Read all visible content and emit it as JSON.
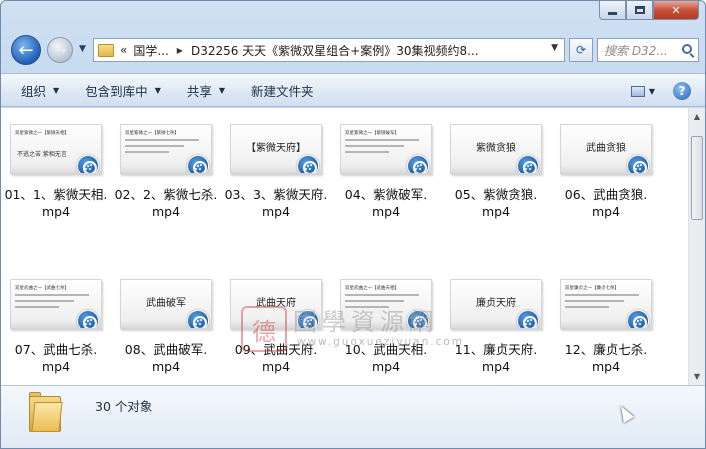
{
  "window": {
    "caption_buttons": [
      "minimize",
      "maximize",
      "close"
    ]
  },
  "address_bar": {
    "chevron": "«",
    "crumbs": [
      "国学...",
      "D32256 天天《紫微双星组合+案例》30集视频约8..."
    ],
    "search_placeholder": "搜索 D32..."
  },
  "toolbar": {
    "organize": "组织",
    "include_in_library": "包含到库中",
    "share": "共享",
    "new_folder": "新建文件夹"
  },
  "files": [
    {
      "name": "01、1、紫微天相.mp4",
      "line1": "01、1、紫微天相.",
      "line2": "mp4",
      "thumb_header": "双星紫微之一【紫微天相】",
      "thumb_big": "",
      "thumb_sub": "不逃之苦    紫相无言"
    },
    {
      "name": "02、2、紫微七杀.mp4",
      "line1": "02、2、紫微七杀.",
      "line2": "mp4",
      "thumb_header": "双星紫微之一【紫微七杀】",
      "thumb_big": "",
      "thumb_sub": ""
    },
    {
      "name": "03、3、紫微天府.mp4",
      "line1": "03、3、紫微天府.",
      "line2": "mp4",
      "thumb_header": "",
      "thumb_big": "【紫微天府】",
      "thumb_sub": ""
    },
    {
      "name": "04、紫微破军.mp4",
      "line1": "04、紫微破军.",
      "line2": "mp4",
      "thumb_header": "双星紫微之一【紫微破军】",
      "thumb_big": "",
      "thumb_sub": ""
    },
    {
      "name": "05、紫微贪狼.mp4",
      "line1": "05、紫微贪狼.",
      "line2": "mp4",
      "thumb_header": "",
      "thumb_big": "紫微贪狼",
      "thumb_sub": ""
    },
    {
      "name": "06、武曲贪狼.mp4",
      "line1": "06、武曲贪狼.",
      "line2": "mp4",
      "thumb_header": "",
      "thumb_big": "武曲贪狼",
      "thumb_sub": ""
    },
    {
      "name": "07、武曲七杀.mp4",
      "line1": "07、武曲七杀.",
      "line2": "mp4",
      "thumb_header": "双星武曲之一【武曲七杀】",
      "thumb_big": "",
      "thumb_sub": ""
    },
    {
      "name": "08、武曲破军.mp4",
      "line1": "08、武曲破军.",
      "line2": "mp4",
      "thumb_header": "",
      "thumb_big": "武曲破军",
      "thumb_sub": ""
    },
    {
      "name": "09、武曲天府.mp4",
      "line1": "09、武曲天府.",
      "line2": "mp4",
      "thumb_header": "",
      "thumb_big": "武曲天府",
      "thumb_sub": ""
    },
    {
      "name": "10、武曲天相.mp4",
      "line1": "10、武曲天相.",
      "line2": "mp4",
      "thumb_header": "双星武曲之一【武曲天相】",
      "thumb_big": "",
      "thumb_sub": ""
    },
    {
      "name": "11、廉贞天府.mp4",
      "line1": "11、廉贞天府.",
      "line2": "mp4",
      "thumb_header": "",
      "thumb_big": "廉贞天府",
      "thumb_sub": ""
    },
    {
      "name": "12、廉贞七杀.mp4",
      "line1": "12、廉贞七杀.",
      "line2": "mp4",
      "thumb_header": "双星廉贞之一【廉贞七杀】",
      "thumb_big": "",
      "thumb_sub": ""
    }
  ],
  "watermark": {
    "seal": "德",
    "text": "國學資源網",
    "url": "www.guoxueziyuan.com"
  },
  "details": {
    "count_text": "30 个对象"
  },
  "icons": {
    "back": "back-arrow-icon",
    "forward": "forward-arrow-icon",
    "refresh": "refresh-icon",
    "search": "search-icon",
    "view": "view-options-icon",
    "help": "help-icon",
    "file_badge": "video-file-icon"
  }
}
